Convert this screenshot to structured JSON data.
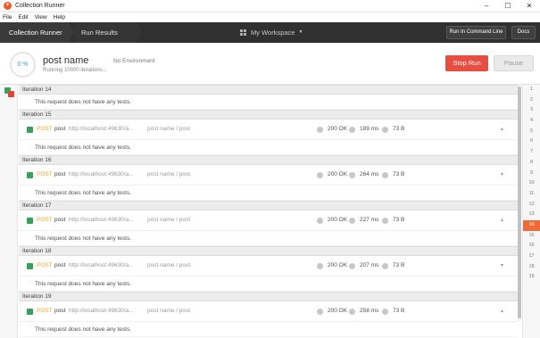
{
  "window": {
    "title": "Collection Runner",
    "app_icon": "postman-icon",
    "controls": [
      "–",
      "☐",
      "✕"
    ]
  },
  "menu": [
    "File",
    "Edit",
    "View",
    "Help"
  ],
  "header": {
    "breadcrumb_1": "Collection Runner",
    "breadcrumb_2": "Run Results",
    "workspace": "My Workspace",
    "run_in_command_line": "Run In Command Line",
    "docs": "Docs"
  },
  "summary": {
    "progress": "0 %",
    "name": "post name",
    "subtitle": "Running 10000 iterations...",
    "environment": "No Environment",
    "stop_label": "Stop Run",
    "pause_label": "Pause",
    "stop_color": "#e64e42"
  },
  "first_iteration": {
    "label": "Iteration 14",
    "message": "This request does not have any tests."
  },
  "iterations": [
    {
      "label": "Iteration 15",
      "method": "POST",
      "name": "post",
      "url": "http://localhost:49630/a...",
      "path": "post name / post",
      "status": "200 OK",
      "time": "189 ms",
      "size": "73 B",
      "chevron": "▴",
      "message": "This request does not have any tests."
    },
    {
      "label": "Iteration 16",
      "method": "POST",
      "name": "post",
      "url": "http://localhost:49630/a...",
      "path": "post name / post",
      "status": "200 OK",
      "time": "264 ms",
      "size": "73 B",
      "chevron": "▾",
      "message": "This request does not have any tests."
    },
    {
      "label": "Iteration 17",
      "method": "POST",
      "name": "post",
      "url": "http://localhost:49630/a...",
      "path": "post name / post",
      "status": "200 OK",
      "time": "227 ms",
      "size": "73 B",
      "chevron": "▴",
      "message": "This request does not have any tests."
    },
    {
      "label": "Iteration 18",
      "method": "POST",
      "name": "post",
      "url": "http://localhost:49630/a...",
      "path": "post name / post",
      "status": "200 OK",
      "time": "207 ms",
      "size": "73 B",
      "chevron": "▾",
      "message": "This request does not have any tests."
    },
    {
      "label": "Iteration 19",
      "method": "POST",
      "name": "post",
      "url": "http://localhost:49630/a...",
      "path": "post name / post",
      "status": "200 OK",
      "time": "258 ms",
      "size": "73 B",
      "chevron": "▴",
      "message": "This request does not have any tests."
    }
  ],
  "iteration_index": {
    "numbers": [
      "1",
      "2",
      "3",
      "4",
      "5",
      "6",
      "7",
      "8",
      "9",
      "10",
      "11",
      "12",
      "13",
      "14",
      "15",
      "16",
      "17",
      "18",
      "19"
    ],
    "active": "14",
    "active_color": "#ef6a37"
  }
}
